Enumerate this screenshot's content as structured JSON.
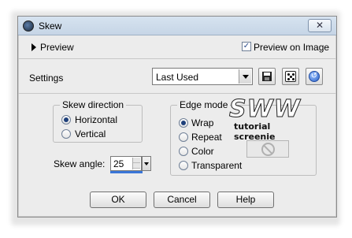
{
  "window": {
    "title": "Skew",
    "close_glyph": "✕"
  },
  "preview": {
    "label": "Preview",
    "preview_on_image_label": "Preview on Image",
    "preview_on_image_checked": true
  },
  "settings": {
    "label": "Settings",
    "selected": "Last Used"
  },
  "skew_direction": {
    "title": "Skew direction",
    "options": [
      {
        "label": "Horizontal",
        "selected": true
      },
      {
        "label": "Vertical",
        "selected": false
      }
    ]
  },
  "skew_angle": {
    "label": "Skew angle:",
    "value": "25"
  },
  "edge_mode": {
    "title": "Edge mode",
    "options": [
      {
        "label": "Wrap",
        "selected": true
      },
      {
        "label": "Repeat",
        "selected": false
      },
      {
        "label": "Color",
        "selected": false
      },
      {
        "label": "Transparent",
        "selected": false
      }
    ]
  },
  "watermark": {
    "logo_text": "SWW",
    "caption": "tutorial screenie"
  },
  "buttons": {
    "ok": "OK",
    "cancel": "Cancel",
    "help": "Help"
  },
  "icons": [
    "app-icon",
    "close-icon",
    "expand-triangle-icon",
    "save-icon",
    "randomize-dice-icon",
    "reset-icon",
    "no-symbol-icon"
  ],
  "colors": {
    "titlebar": "#c6d5e6",
    "dialog_bg": "#ececec",
    "accent_blue": "#3a76d8"
  }
}
